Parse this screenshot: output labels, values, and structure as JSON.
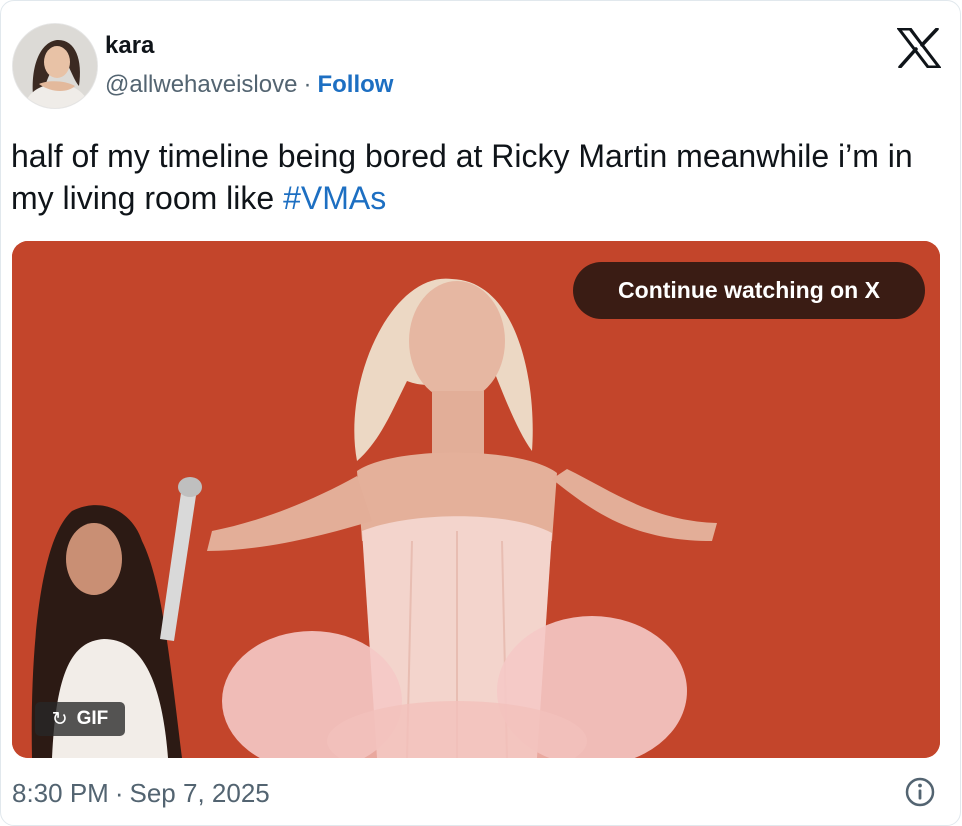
{
  "author": {
    "display_name": "kara",
    "handle": "@allwehaveislove",
    "separator": "·",
    "follow_label": "Follow"
  },
  "header": {
    "logo_icon": "x-logo-icon"
  },
  "tweet": {
    "text": "half of my timeline being bored at Ricky Martin meanwhile i’m in my living room like ",
    "hashtag": "#VMAs"
  },
  "media": {
    "type": "gif",
    "continue_label": "Continue watching on X",
    "gif_label": "GIF",
    "reload_icon": "reload-icon",
    "colors": {
      "background": "#c7472b",
      "button_bg": "#3a1c14"
    }
  },
  "footer": {
    "time": "8:30 PM",
    "separator": "·",
    "date": "Sep 7, 2025",
    "info_icon": "info-icon"
  },
  "colors": {
    "link": "#1d6fc2",
    "secondary_text": "#536471",
    "primary_text": "#0f1419"
  }
}
